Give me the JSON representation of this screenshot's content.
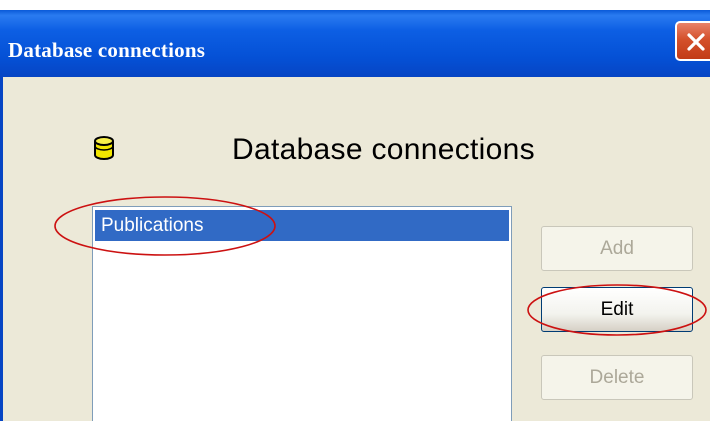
{
  "window": {
    "title": "Database connections"
  },
  "dialog": {
    "heading": "Database connections",
    "connections": [
      {
        "label": "Publications",
        "selected": true
      }
    ],
    "buttons": {
      "add_label": "Add",
      "edit_label": "Edit",
      "delete_label": "Delete"
    }
  },
  "colors": {
    "titlebar": "#0551d6",
    "selection": "#316ac5",
    "annotation": "#cc1111",
    "icon": "#f2e600"
  },
  "icons": {
    "close": "close-icon",
    "database": "database-icon"
  }
}
